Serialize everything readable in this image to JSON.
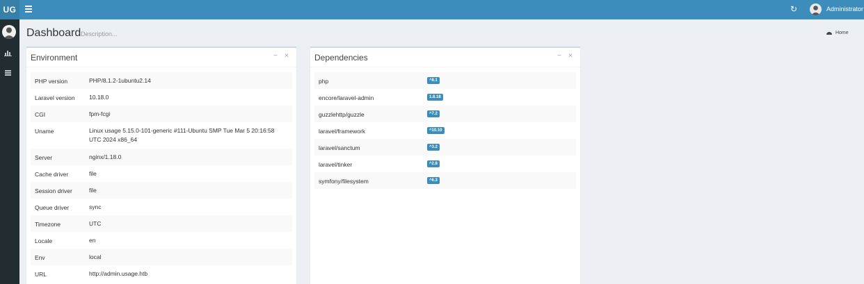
{
  "header": {
    "logo": "UG",
    "user_name": "Administrator"
  },
  "page": {
    "title": "Dashboard",
    "description": "Description...",
    "breadcrumb": "Home"
  },
  "environment": {
    "title": "Environment",
    "rows": [
      {
        "key": "PHP version",
        "value": "PHP/8.1.2-1ubuntu2.14"
      },
      {
        "key": "Laravel version",
        "value": "10.18.0"
      },
      {
        "key": "CGI",
        "value": "fpm-fcgi"
      },
      {
        "key": "Uname",
        "value": "Linux usage 5.15.0-101-generic #111-Ubuntu SMP Tue Mar 5 20:16:58 UTC 2024 x86_64"
      },
      {
        "key": "Server",
        "value": "nginx/1.18.0"
      },
      {
        "key": "Cache driver",
        "value": "file"
      },
      {
        "key": "Session driver",
        "value": "file"
      },
      {
        "key": "Queue driver",
        "value": "sync"
      },
      {
        "key": "Timezone",
        "value": "UTC"
      },
      {
        "key": "Locale",
        "value": "en"
      },
      {
        "key": "Env",
        "value": "local"
      },
      {
        "key": "URL",
        "value": "http://admin.usage.htb"
      }
    ]
  },
  "dependencies": {
    "title": "Dependencies",
    "rows": [
      {
        "name": "php",
        "version": "^8.1"
      },
      {
        "name": "encore/laravel-admin",
        "version": "1.8.18"
      },
      {
        "name": "guzzlehttp/guzzle",
        "version": "^7.2"
      },
      {
        "name": "laravel/framework",
        "version": "^10.10"
      },
      {
        "name": "laravel/sanctum",
        "version": "^3.2"
      },
      {
        "name": "laravel/tinker",
        "version": "^2.8"
      },
      {
        "name": "symfony/filesystem",
        "version": "^6.3"
      }
    ]
  },
  "icons": {
    "menu": "hamburger-icon",
    "refresh": "refresh-icon",
    "dashboard": "bar-chart-icon",
    "list": "list-icon",
    "home": "dashboard-icon",
    "collapse": "minus-icon",
    "remove": "close-icon"
  },
  "colors": {
    "header": "#3c8dbc",
    "logo": "#367fa9",
    "sidebar": "#222d32",
    "badge": "#3c8dbc",
    "background": "#ecf0f5"
  }
}
